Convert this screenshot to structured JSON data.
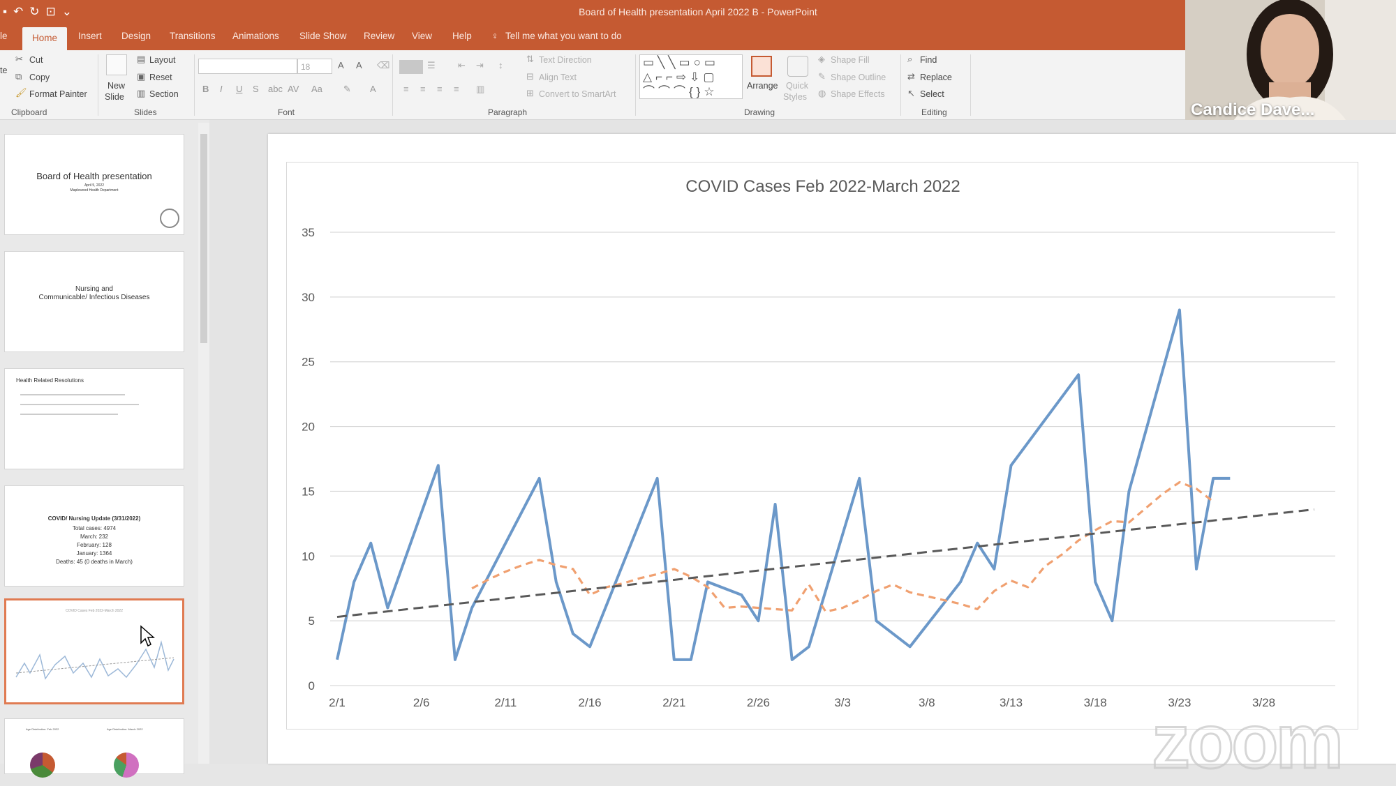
{
  "window": {
    "title": "Board of Health presentation April 2022 B  -  PowerPoint"
  },
  "tabs": [
    {
      "label": "le"
    },
    {
      "label": "Home"
    },
    {
      "label": "Insert"
    },
    {
      "label": "Design"
    },
    {
      "label": "Transitions"
    },
    {
      "label": "Animations"
    },
    {
      "label": "Slide Show"
    },
    {
      "label": "Review"
    },
    {
      "label": "View"
    },
    {
      "label": "Help"
    }
  ],
  "tell_me": "Tell me what you want to do",
  "ribbon": {
    "clipboard": {
      "cut": "Cut",
      "copy": "Copy",
      "format_painter": "Format Painter",
      "paste_frag": "te",
      "group": "Clipboard"
    },
    "slides": {
      "new_slide_1": "New",
      "new_slide_2": "Slide",
      "layout": "Layout",
      "reset": "Reset",
      "section": "Section",
      "group": "Slides"
    },
    "font": {
      "size": "18",
      "group": "Font"
    },
    "paragraph": {
      "text_direction": "Text Direction",
      "align_text": "Align Text",
      "convert_smartart": "Convert to SmartArt",
      "group": "Paragraph"
    },
    "drawing": {
      "arrange": "Arrange",
      "quick_styles_1": "Quick",
      "quick_styles_2": "Styles",
      "shape_fill": "Shape Fill",
      "shape_outline": "Shape Outline",
      "shape_effects": "Shape Effects",
      "group": "Drawing"
    },
    "editing": {
      "find": "Find",
      "replace": "Replace",
      "select": "Select",
      "group": "Editing"
    }
  },
  "webcam": {
    "name": "Candice Dave..."
  },
  "thumbnails": [
    {
      "line1": "Board of Health presentation",
      "line2": "April 5, 2022",
      "line3": "Maplewood Health Department"
    },
    {
      "line1": "Nursing and",
      "line2": "Communicable/ Infectious Diseases"
    },
    {
      "line1": "Health Related Resolutions"
    },
    {
      "line1": "COVID/ Nursing Update (3/31/2022)",
      "line2": "Total cases: 4974",
      "line3": "March: 232",
      "line4": "February: 128",
      "line5": "January: 1364",
      "line6": "Deaths: 45 (0 deaths in March)"
    },
    {
      "line1": "COVID Cases Feb 2022-March 2022"
    },
    {
      "line1": "Age Distribution: Feb 2022",
      "line2": "Age Distribution: March 2022"
    }
  ],
  "watermark": "zoom",
  "chart_data": {
    "type": "line",
    "title": "COVID Cases Feb 2022-March 2022",
    "xlabel": "",
    "ylabel": "",
    "ylim": [
      0,
      35
    ],
    "yticks": [
      0,
      5,
      10,
      15,
      20,
      25,
      30,
      35
    ],
    "x": [
      "2/1",
      "2/2",
      "2/3",
      "2/4",
      "2/5",
      "2/6",
      "2/7",
      "2/8",
      "2/9",
      "2/10",
      "2/11",
      "2/12",
      "2/13",
      "2/14",
      "2/15",
      "2/16",
      "2/17",
      "2/18",
      "2/19",
      "2/20",
      "2/21",
      "2/22",
      "2/23",
      "2/24",
      "2/25",
      "2/26",
      "2/27",
      "2/28",
      "3/1",
      "3/2",
      "3/3",
      "3/4",
      "3/5",
      "3/6",
      "3/7",
      "3/8",
      "3/9",
      "3/10",
      "3/11",
      "3/12",
      "3/13",
      "3/14",
      "3/15",
      "3/16",
      "3/17",
      "3/18",
      "3/19",
      "3/20",
      "3/21",
      "3/22",
      "3/23",
      "3/24",
      "3/25",
      "3/26",
      "3/27",
      "3/28",
      "3/29",
      "3/30",
      "3/31"
    ],
    "xticks": [
      "2/1",
      "2/6",
      "2/11",
      "2/16",
      "2/21",
      "2/26",
      "3/3",
      "3/8",
      "3/13",
      "3/18",
      "3/23",
      "3/28"
    ],
    "grid": true,
    "series": [
      {
        "values": [
          2,
          8,
          11,
          6,
          null,
          null,
          17,
          2,
          6,
          null,
          null,
          null,
          16,
          8,
          4,
          3,
          null,
          null,
          null,
          16,
          2,
          2,
          8,
          null,
          7,
          5,
          14,
          2,
          3,
          null,
          null,
          16,
          5,
          null,
          3,
          null,
          null,
          8,
          11,
          9,
          17,
          null,
          null,
          null,
          24,
          8,
          5,
          15,
          null,
          null,
          29,
          9,
          16,
          16
        ],
        "color": "#6b98c9",
        "style": "solid"
      },
      {
        "values": [
          null,
          null,
          null,
          null,
          null,
          null,
          null,
          null,
          7.5,
          8.2,
          8.8,
          9.3,
          9.7,
          9.3,
          9.0,
          7.0,
          7.6,
          7.9,
          8.3,
          8.6,
          9.0,
          8.4,
          7.6,
          6.0,
          6.1,
          6.0,
          5.9,
          5.8,
          7.8,
          5.7,
          6.0,
          6.6,
          7.3,
          7.8,
          7.2,
          6.9,
          6.6,
          6.3,
          5.9,
          7.3,
          8.1,
          7.6,
          9.2,
          10.1,
          11.2,
          12.0,
          12.7,
          12.6,
          13.7,
          14.8,
          15.7,
          15.2,
          14.2,
          null
        ],
        "color": "#f0a070",
        "style": "dashed"
      },
      {
        "values": [
          5.3,
          13.6
        ],
        "color": "#595959",
        "style": "dashed-trend"
      }
    ]
  }
}
